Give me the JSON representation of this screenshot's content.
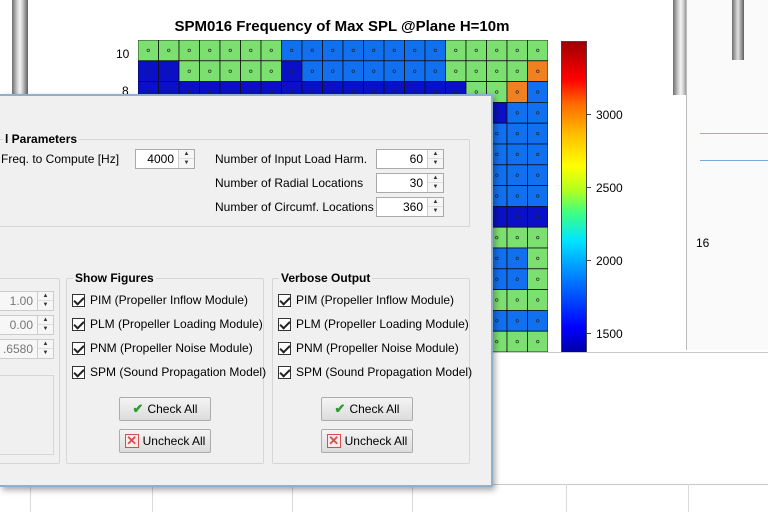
{
  "figure": {
    "title": "SPM016 Frequency of Max SPL @Plane H=10m",
    "y_ticks": [
      "10",
      "8"
    ],
    "colorbar_ticks": [
      "3000",
      "2500",
      "2000",
      "1500"
    ],
    "right_label": "16",
    "colors": {
      "dark_blue": "#0a10c8",
      "blue": "#1070f0",
      "green": "#7ce070",
      "orange": "#f08020"
    }
  },
  "dialog": {
    "general_parameters": {
      "title": "l Parameters",
      "fields": [
        {
          "label": "Freq. to Compute [Hz]",
          "value": "4000"
        },
        {
          "label": "Number of Input Load Harm.",
          "value": "60"
        },
        {
          "label": "Number of Radial Locations",
          "value": "30"
        },
        {
          "label": "Number of Circumf. Locations",
          "value": "360"
        }
      ]
    },
    "left_spinners": [
      "1.00",
      "0.00",
      ".6580"
    ],
    "show_figures": {
      "title": "Show Figures",
      "items": [
        "PIM (Propeller Inflow Module)",
        "PLM (Propeller Loading Module)",
        "PNM (Propeller Noise Module)",
        "SPM (Sound Propagation Model)"
      ],
      "check_all": "Check All",
      "uncheck_all": "Uncheck All"
    },
    "verbose_output": {
      "title": "Verbose Output",
      "items": [
        "PIM (Propeller Inflow Module)",
        "PLM (Propeller Loading Module)",
        "PNM (Propeller Noise Module)",
        "SPM (Sound Propagation Model)"
      ],
      "check_all": "Check All",
      "uncheck_all": "Uncheck All"
    }
  }
}
